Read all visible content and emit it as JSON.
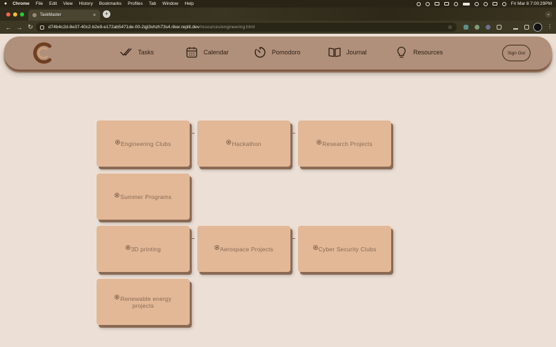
{
  "menubar": {
    "apple": "",
    "items": [
      "Chrome",
      "File",
      "Edit",
      "View",
      "History",
      "Bookmarks",
      "Profiles",
      "Tab",
      "Window",
      "Help"
    ],
    "clock": "Fri Mar 8  7:00:29PM"
  },
  "browser": {
    "tab_title": "TaskMaster",
    "tab_close": "×",
    "new_tab": "+",
    "url_host": "d74b4c2d-8e37-40c2-b2e9-e172ab5471de-00-2qji3vhzh73s4.riker.replit.dev",
    "url_path": "/resources/engineering.html"
  },
  "nav": {
    "links": [
      {
        "label": "Tasks",
        "icon": "checkmark-icon"
      },
      {
        "label": "Calendar",
        "icon": "calendar-icon"
      },
      {
        "label": "Pomodoro",
        "icon": "timer-icon"
      },
      {
        "label": "Journal",
        "icon": "book-icon"
      },
      {
        "label": "Resources",
        "icon": "lightbulb-icon"
      }
    ],
    "sign_out": "Sign Out"
  },
  "cards": [
    "Engineering Clubs",
    "Hackathon",
    "Research Projects",
    "Summer Programs",
    "3D printing",
    "Aerospace Projects",
    "Cyber Security Clubs",
    "Renewable energy projects"
  ],
  "colors": {
    "page_bg": "#ece0d6",
    "header_bg": "#b0907a",
    "card_bg": "#e2b897",
    "card_text": "#8a6a52"
  }
}
